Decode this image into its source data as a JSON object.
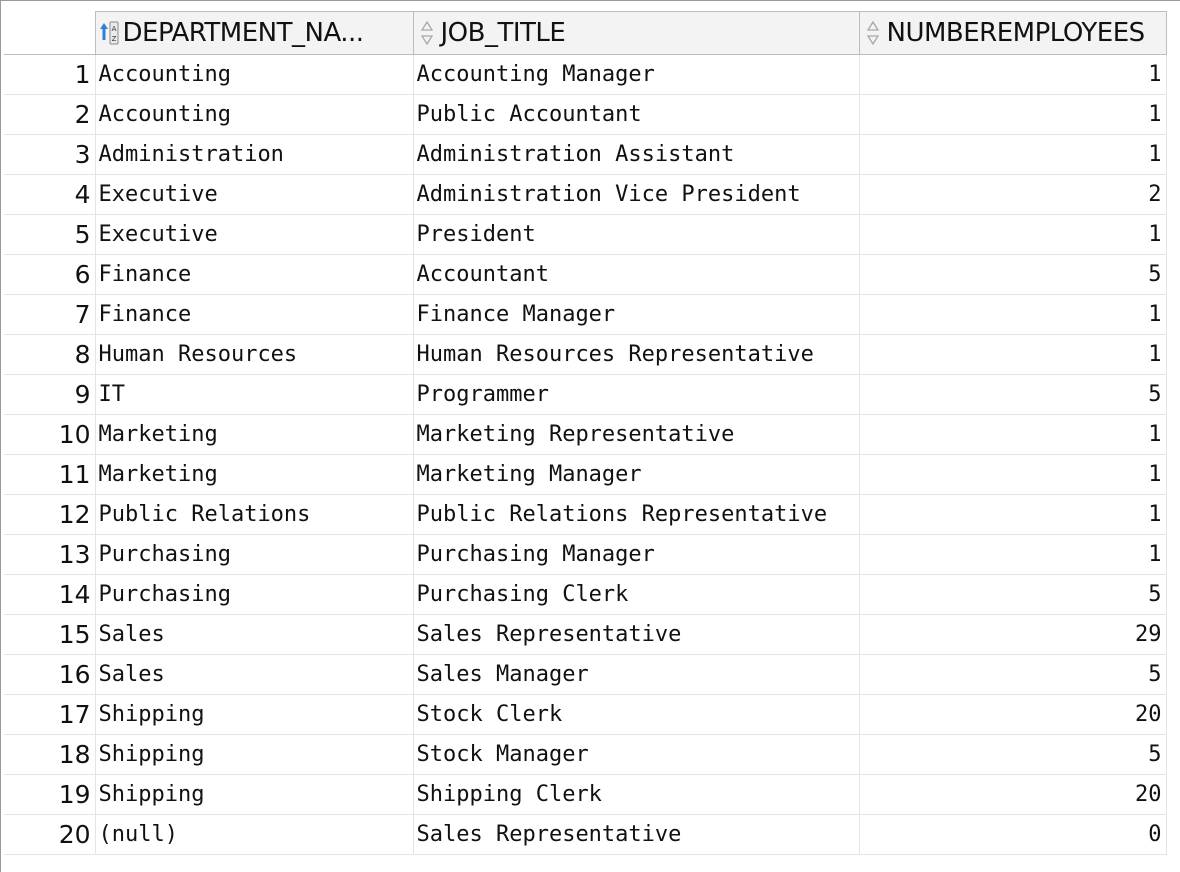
{
  "grid": {
    "columns": [
      {
        "label": "DEPARTMENT_NA...",
        "sort_icon": "sort-ascending-icon"
      },
      {
        "label": "JOB_TITLE",
        "sort_icon": "sort-neutral-icon"
      },
      {
        "label": "NUMBEREMPLOYEES",
        "sort_icon": "sort-neutral-icon"
      }
    ],
    "rows": [
      {
        "n": "1",
        "dept": "Accounting",
        "job": "Accounting Manager",
        "num": "1"
      },
      {
        "n": "2",
        "dept": "Accounting",
        "job": "Public Accountant",
        "num": "1"
      },
      {
        "n": "3",
        "dept": "Administration",
        "job": "Administration Assistant",
        "num": "1"
      },
      {
        "n": "4",
        "dept": "Executive",
        "job": "Administration Vice President",
        "num": "2"
      },
      {
        "n": "5",
        "dept": "Executive",
        "job": "President",
        "num": "1"
      },
      {
        "n": "6",
        "dept": "Finance",
        "job": "Accountant",
        "num": "5"
      },
      {
        "n": "7",
        "dept": "Finance",
        "job": "Finance Manager",
        "num": "1"
      },
      {
        "n": "8",
        "dept": "Human Resources",
        "job": "Human Resources Representative",
        "num": "1"
      },
      {
        "n": "9",
        "dept": "IT",
        "job": "Programmer",
        "num": "5"
      },
      {
        "n": "10",
        "dept": "Marketing",
        "job": "Marketing Representative",
        "num": "1"
      },
      {
        "n": "11",
        "dept": "Marketing",
        "job": "Marketing Manager",
        "num": "1"
      },
      {
        "n": "12",
        "dept": "Public Relations",
        "job": "Public Relations Representative",
        "num": "1"
      },
      {
        "n": "13",
        "dept": "Purchasing",
        "job": "Purchasing Manager",
        "num": "1"
      },
      {
        "n": "14",
        "dept": "Purchasing",
        "job": "Purchasing Clerk",
        "num": "5"
      },
      {
        "n": "15",
        "dept": "Sales",
        "job": "Sales Representative",
        "num": "29"
      },
      {
        "n": "16",
        "dept": "Sales",
        "job": "Sales Manager",
        "num": "5"
      },
      {
        "n": "17",
        "dept": "Shipping",
        "job": "Stock Clerk",
        "num": "20"
      },
      {
        "n": "18",
        "dept": "Shipping",
        "job": "Stock Manager",
        "num": "5"
      },
      {
        "n": "19",
        "dept": "Shipping",
        "job": "Shipping Clerk",
        "num": "20"
      },
      {
        "n": "20",
        "dept": "(null)",
        "job": "Sales Representative",
        "num": "0"
      }
    ]
  }
}
